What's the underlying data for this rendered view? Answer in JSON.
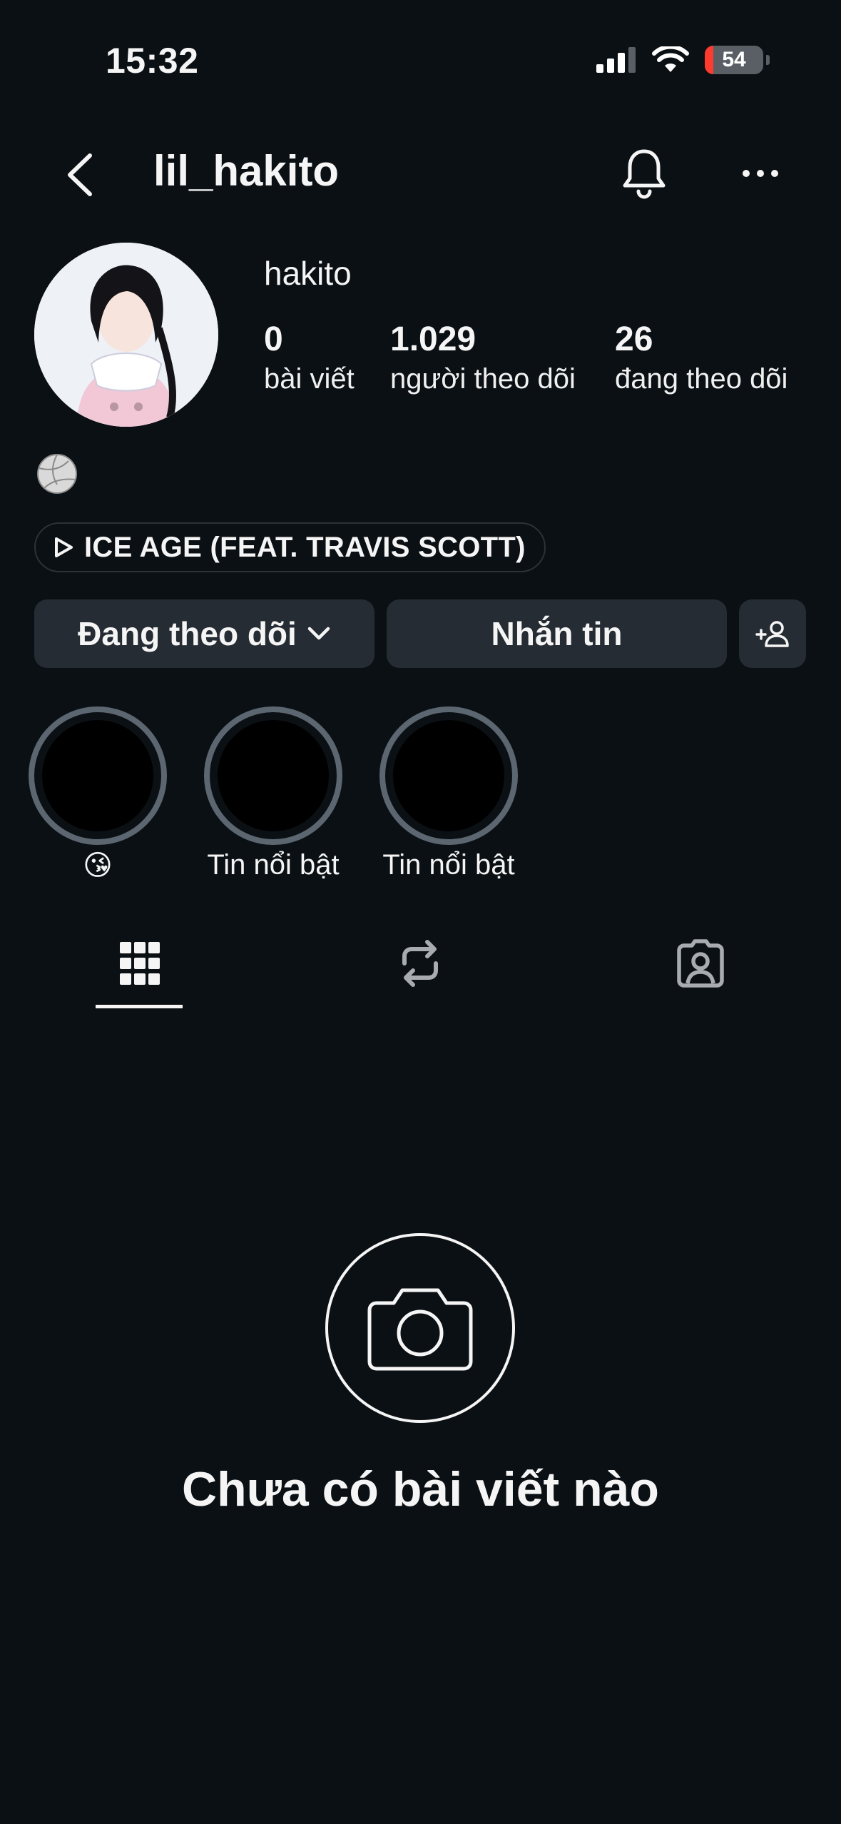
{
  "status_bar": {
    "time": "15:32",
    "battery": "54"
  },
  "header": {
    "username": "lil_hakito"
  },
  "profile": {
    "display_name": "hakito",
    "stats": [
      {
        "value": "0",
        "label": "bài viết"
      },
      {
        "value": "1.029",
        "label": "người theo dõi"
      },
      {
        "value": "26",
        "label": "đang theo dõi"
      }
    ],
    "bio_emoji": "volleyball",
    "music": "ICE AGE (FEAT. TRAVIS SCOTT)"
  },
  "actions": {
    "following_label": "Đang theo dõi",
    "message_label": "Nhắn tin"
  },
  "highlights": [
    {
      "label": "😘"
    },
    {
      "label": "Tin nổi bật"
    },
    {
      "label": "Tin nổi bật"
    }
  ],
  "tabs": [
    "grid-icon",
    "reposts-icon",
    "tagged-icon"
  ],
  "empty_state": {
    "title": "Chưa có bài viết nào"
  },
  "colors": {
    "background": "#0b1014",
    "button": "#262c33",
    "highlight_ring": "#5c6670"
  }
}
